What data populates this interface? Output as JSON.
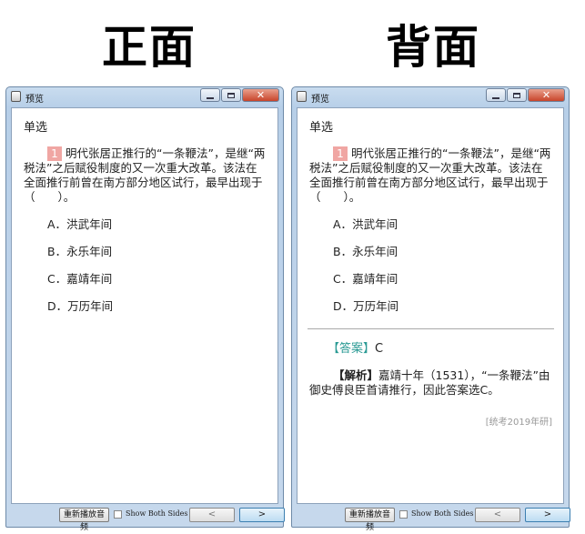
{
  "headings": {
    "front": "正面",
    "back": "背面"
  },
  "window": {
    "title": "预览",
    "controls": {
      "close": "✕"
    }
  },
  "question": {
    "type": "单选",
    "number": "1",
    "stem": "明代张居正推行的“一条鞭法”，是继“两税法”之后赋役制度的又一次重大改革。该法在全面推行前曾在南方部分地区试行，最早出现于（　　）。",
    "options": [
      {
        "letter": "A．",
        "text": "洪武年间"
      },
      {
        "letter": "B．",
        "text": "永乐年间"
      },
      {
        "letter": "C．",
        "text": "嘉靖年间"
      },
      {
        "letter": "D．",
        "text": "万历年间"
      }
    ]
  },
  "answer": {
    "label": "【答案】",
    "value": "C",
    "analysis_label": "【解析】",
    "analysis_text": "嘉靖十年（1531），“一条鞭法”由御史傅良臣首请推行，因此答案选C。",
    "source": "[统考2019年研]"
  },
  "bottombar": {
    "replay_label": "重新播放音频",
    "show_both_label": "Show Both Sides",
    "show_both_checked": false,
    "prev_label": "<",
    "next_label": ">"
  },
  "colors": {
    "qnum_bg": "#f0a6a3",
    "answer_label": "#2a9a94",
    "close_button": "#c8442a"
  }
}
